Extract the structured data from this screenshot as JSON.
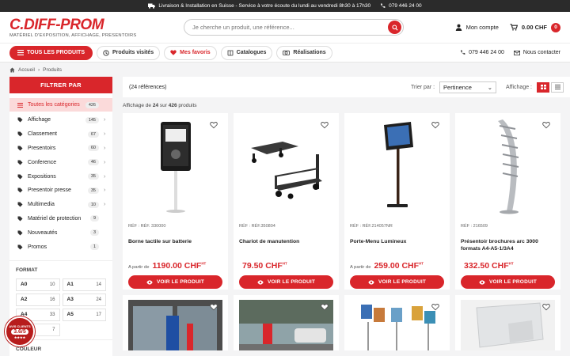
{
  "topbar": {
    "message": "Livraison & Installation en Suisse - Service à votre écoute du lundi au vendredi 8h30 à 17h30",
    "phone": "079 446 24 00"
  },
  "header": {
    "logo_name": "C.DIFF-PROM",
    "logo_tagline": "MATÉRIEL D'EXPOSITION, AFFICHAGE, PRESENTOIRS",
    "search_placeholder": "Je cherche un produit, une référence...",
    "account_label": "Mon compte",
    "cart_total": "0.00 CHF",
    "cart_count": "0"
  },
  "nav": {
    "all_products": "TOUS LES PRODUITS",
    "visited": "Produits visités",
    "favorites": "Mes favoris",
    "catalogues": "Catalogues",
    "realisations": "Réalisations",
    "phone": "079 446 24 00",
    "contact": "Nous contacter"
  },
  "breadcrumb": {
    "home": "Accueil",
    "current": "Produits"
  },
  "sidebar": {
    "filter_title": "FILTRER PAR",
    "categories": [
      {
        "label": "Toutes les catégories",
        "count": "426"
      },
      {
        "label": "Affichage",
        "count": "145"
      },
      {
        "label": "Classement",
        "count": "67"
      },
      {
        "label": "Presentoirs",
        "count": "60"
      },
      {
        "label": "Conference",
        "count": "46"
      },
      {
        "label": "Expositions",
        "count": "35"
      },
      {
        "label": "Presentoir presse",
        "count": "35"
      },
      {
        "label": "Multimedia",
        "count": "10"
      },
      {
        "label": "Matériel de protection",
        "count": "9"
      },
      {
        "label": "Nouveautés",
        "count": "3"
      },
      {
        "label": "Promos",
        "count": "1"
      }
    ],
    "format_title": "FORMAT",
    "formats": [
      {
        "label": "A0",
        "count": "10"
      },
      {
        "label": "A1",
        "count": "14"
      },
      {
        "label": "A2",
        "count": "16"
      },
      {
        "label": "A3",
        "count": "24"
      },
      {
        "label": "A4",
        "count": "33"
      },
      {
        "label": "A5",
        "count": "17"
      },
      {
        "label": "",
        "count": "7"
      }
    ],
    "color_title": "COULEUR"
  },
  "toolbar": {
    "refs": "(24 références)",
    "sort_label": "Trier par :",
    "sort_value": "Pertinence",
    "display_label": "Affichage :"
  },
  "showing": {
    "prefix": "Affichage de",
    "shown": "24",
    "mid": "sur",
    "total": "426",
    "suffix": "produits"
  },
  "products": [
    {
      "ref": "RÉF : RÉF. 330000",
      "name": "Borne tactile sur batterie",
      "from": "A partir de",
      "price": "1190.00 CHF",
      "ht": "HT",
      "button": "VOIR LE PRODUIT"
    },
    {
      "ref": "RÉF : RÉF.350804",
      "name": "Chariot de manutention",
      "from": "",
      "price": "79.50 CHF",
      "ht": "HT",
      "button": "VOIR LE PRODUIT"
    },
    {
      "ref": "RÉF : RÉF.214057NR",
      "name": "Porte-Menu Lumineux",
      "from": "A partir de",
      "price": "259.00 CHF",
      "ht": "HT",
      "button": "VOIR LE PRODUIT"
    },
    {
      "ref": "RÉF : 216509",
      "name": "Présentoir brochures arc 3000 formats A4-A5-1/3A4",
      "from": "",
      "price": "332.50 CHF",
      "ht": "HT",
      "button": "VOIR LE PRODUIT"
    }
  ],
  "seal": {
    "score": "3.6/5",
    "label": "AVIS CLIENTS"
  },
  "colors": {
    "accent": "#d9262b",
    "topbar": "#2b2b2b"
  }
}
